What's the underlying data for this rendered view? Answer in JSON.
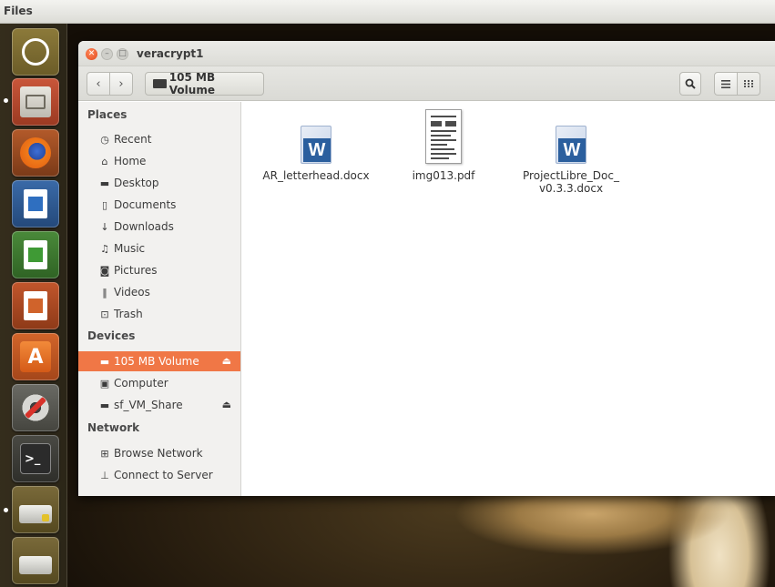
{
  "top_panel": {
    "title": "Files"
  },
  "launcher": {
    "items": [
      {
        "name": "dash-icon"
      },
      {
        "name": "files-icon"
      },
      {
        "name": "firefox-icon"
      },
      {
        "name": "writer-icon"
      },
      {
        "name": "calc-icon"
      },
      {
        "name": "impress-icon"
      },
      {
        "name": "software-center-icon"
      },
      {
        "name": "system-settings-icon"
      },
      {
        "name": "terminal-icon"
      },
      {
        "name": "mounted-drive-icon"
      },
      {
        "name": "removable-drive-icon"
      }
    ]
  },
  "window": {
    "title": "veracrypt1",
    "toolbar": {
      "back_icon": "‹",
      "forward_icon": "›",
      "path_label": "105 MB Volume"
    }
  },
  "sidebar": {
    "places_heading": "Places",
    "places": [
      {
        "label": "Recent",
        "icon": "clock-icon"
      },
      {
        "label": "Home",
        "icon": "home-icon"
      },
      {
        "label": "Desktop",
        "icon": "folder-icon"
      },
      {
        "label": "Documents",
        "icon": "document-icon"
      },
      {
        "label": "Downloads",
        "icon": "download-icon"
      },
      {
        "label": "Music",
        "icon": "music-icon"
      },
      {
        "label": "Pictures",
        "icon": "camera-icon"
      },
      {
        "label": "Videos",
        "icon": "film-icon"
      },
      {
        "label": "Trash",
        "icon": "trash-icon"
      }
    ],
    "devices_heading": "Devices",
    "devices": [
      {
        "label": "105 MB Volume",
        "icon": "drive-icon",
        "selected": true,
        "eject": true
      },
      {
        "label": "Computer",
        "icon": "computer-icon",
        "selected": false,
        "eject": false
      },
      {
        "label": "sf_VM_Share",
        "icon": "drive-icon",
        "selected": false,
        "eject": true
      }
    ],
    "network_heading": "Network",
    "network": [
      {
        "label": "Browse Network",
        "icon": "network-icon"
      },
      {
        "label": "Connect to Server",
        "icon": "server-icon"
      }
    ]
  },
  "files": [
    {
      "name": "AR_letterhead.docx",
      "type": "word"
    },
    {
      "name": "img013.pdf",
      "type": "pdf"
    },
    {
      "name_line1": "ProjectLibre_Doc_",
      "name_line2": "v0.3.3.docx",
      "type": "word"
    }
  ],
  "colors": {
    "selection": "#f07746",
    "window_close": "#e2471b"
  }
}
